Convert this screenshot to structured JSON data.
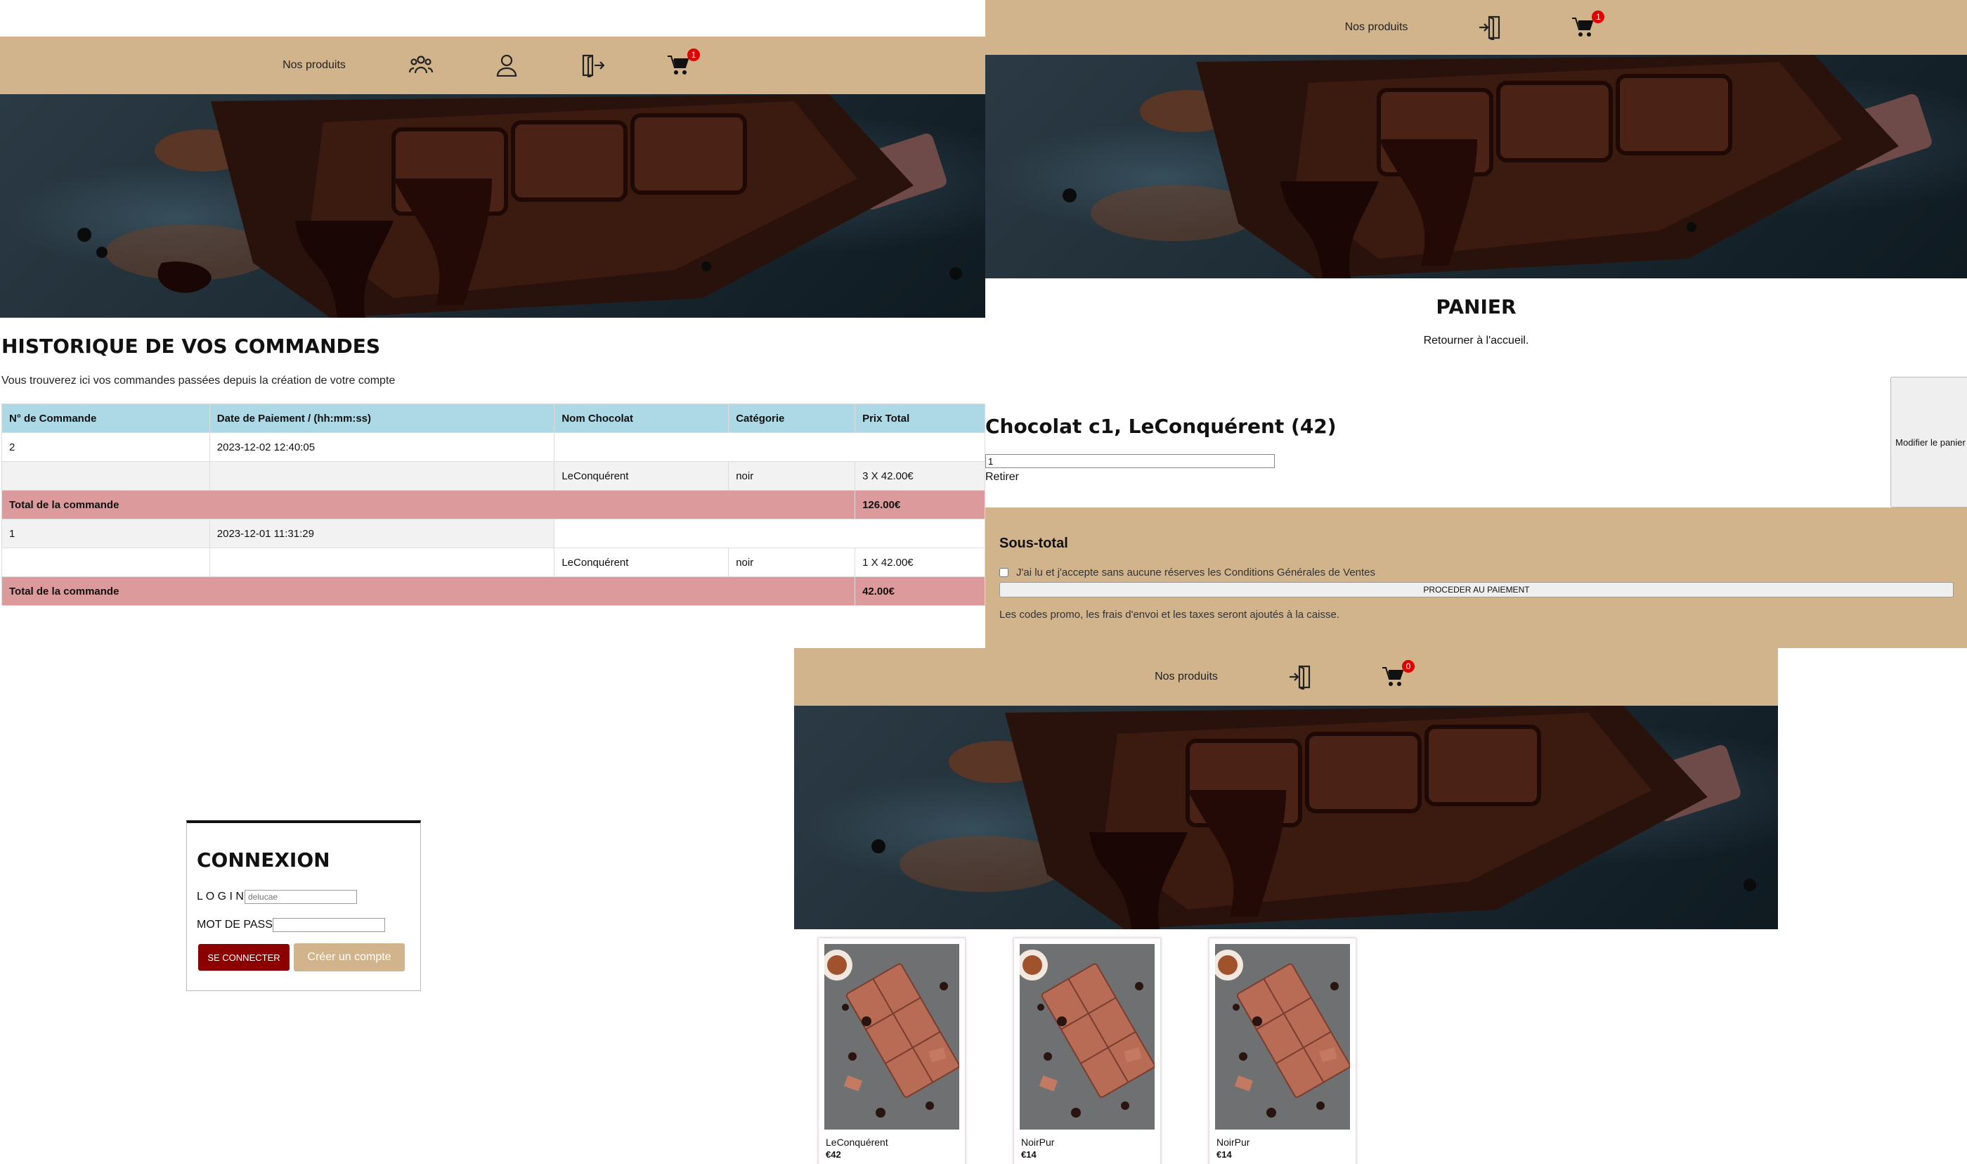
{
  "history_page": {
    "nav": {
      "products_label": "Nos produits",
      "users_icon": "users-icon",
      "account_icon": "user-icon",
      "logout_icon": "logout-icon",
      "cart_icon": "cart-icon",
      "cart_count": "1"
    },
    "title": "HISTORIQUE DE VOS COMMANDES",
    "subtitle": "Vous trouverez ici vos commandes passées depuis la création de votre compte",
    "columns": [
      "N° de Commande",
      "Date de Paiement / (hh:mm:ss)",
      "Nom Chocolat",
      "Catégorie",
      "Prix Total"
    ],
    "orders": [
      {
        "number": "2",
        "date": "2023-12-02 12:40:05",
        "item_name": "LeConquérent",
        "item_category": "noir",
        "item_price": "3 X 42.00€",
        "total_label": "Total de la commande",
        "total": "126.00€"
      },
      {
        "number": "1",
        "date": "2023-12-01 11:31:29",
        "item_name": "LeConquérent",
        "item_category": "noir",
        "item_price": "1 X 42.00€",
        "total_label": "Total de la commande",
        "total": "42.00€"
      }
    ]
  },
  "cart_page": {
    "nav": {
      "products_label": "Nos produits",
      "logout_icon": "logout-icon",
      "cart_icon": "cart-icon",
      "cart_count": "1"
    },
    "title": "PANIER",
    "back_link": "Retourner à l'accueil.",
    "item_title": "Chocolat c1, LeConquérent (42)",
    "quantity": "1",
    "remove_label": "Retirer",
    "update_button": "Modifier le panier",
    "subtotal_title": "Sous-total",
    "cgv_label": "J'ai lu et j'accepte sans aucune réserves les Conditions Générales de Ventes",
    "pay_button": "PROCEDER AU PAIEMENT",
    "note": "Les codes promo, les frais d'envoi et les taxes seront ajoutés à la caisse."
  },
  "login_page": {
    "title": "CONNEXION",
    "login_label": "L O G I N",
    "login_placeholder": "delucae",
    "password_label": "MOT DE PASSE",
    "submit_button": "SE CONNECTER",
    "create_button": "Créer un compte"
  },
  "shop_page": {
    "nav": {
      "products_label": "Nos produits",
      "logout_icon": "logout-icon",
      "cart_icon": "cart-icon",
      "cart_count": "0"
    },
    "products": [
      {
        "name": "LeConquérent",
        "price": "€42"
      },
      {
        "name": "NoirPur",
        "price": "€14"
      },
      {
        "name": "NoirPur",
        "price": "€14"
      }
    ]
  },
  "colors": {
    "nav_bg": "#d2b48c",
    "table_header": "#add8e6",
    "total_row": "#dc9a9c",
    "badge": "#e00000",
    "login_button": "#8b0000",
    "create_button": "#d2b48c"
  }
}
